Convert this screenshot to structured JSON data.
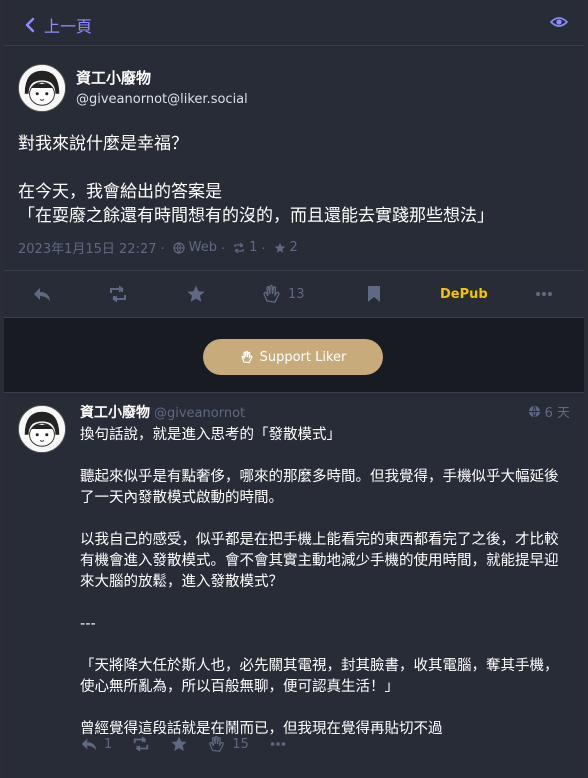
{
  "header": {
    "back_label": "上一頁",
    "back_icon": "chevron-left-icon",
    "visibility_icon": "eye-icon"
  },
  "status": {
    "display_name": "資工小廢物",
    "account": "@giveanornot@liker.social",
    "paragraphs": [
      "對我來說什麼是幸福？",
      "在今天，我會給出的答案是\n「在耍廢之餘還有時間想有的沒的，而且還能去實踐那些想法」"
    ],
    "date": "2023年1月15日 22:27",
    "sep": "·",
    "app": "Web",
    "reblogs": "1",
    "favourites": "2"
  },
  "actions": {
    "likes": "13",
    "depub": "DePub"
  },
  "support_button": "Support Liker",
  "reply": {
    "display_name": "資工小廢物",
    "account": "@giveanornot",
    "time": "6 天",
    "paragraphs": [
      "換句話說，就是進入思考的「發散模式」",
      "聽起來似乎是有點奢侈，哪來的那麼多時間。但我覺得，手機似乎大幅延後了一天內發散模式啟動的時間。",
      "以我自己的感受，似乎都是在把手機上能看完的東西都看完了之後，才比較有機會進入發散模式。會不會其實主動地減少手機的使用時間，就能提早迎來大腦的放鬆，進入發散模式？",
      "---",
      "「天將降大任於斯人也，必先關其電視，封其臉書，收其電腦，奪其手機，使心無所亂為，所以百般無聊，便可認真生活！」",
      "曾經覺得這段話就是在鬧而已，但我現在覺得再貼切不過"
    ],
    "replies": "1",
    "likes": "15"
  },
  "colors": {
    "accent": "#8c8dff",
    "background": "#282c37",
    "muted": "#606984",
    "depub": "#f2c500",
    "support": "#c8ab7a"
  }
}
